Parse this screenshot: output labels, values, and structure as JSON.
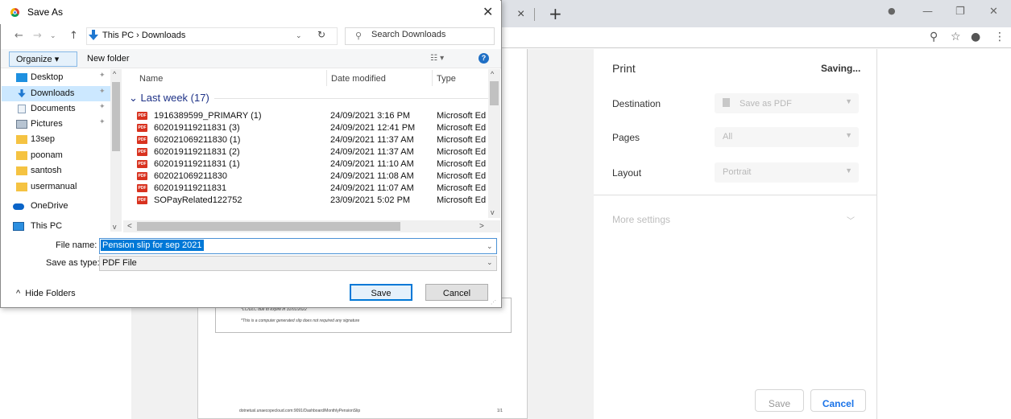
{
  "dialog": {
    "title": "Save As",
    "address": "This PC  ›  Downloads",
    "search_placeholder": "Search Downloads",
    "organize_label": "Organize ▾",
    "new_folder_label": "New folder",
    "help_label": "?",
    "nav_items": [
      {
        "label": "Desktop",
        "icon": "desktop-icon"
      },
      {
        "label": "Downloads",
        "icon": "downloads-icon",
        "selected": true
      },
      {
        "label": "Documents",
        "icon": "documents-icon"
      },
      {
        "label": "Pictures",
        "icon": "pictures-icon"
      },
      {
        "label": "13sep",
        "icon": "folder-icon"
      },
      {
        "label": "poonam",
        "icon": "folder-icon"
      },
      {
        "label": "santosh",
        "icon": "folder-icon"
      },
      {
        "label": "usermanual",
        "icon": "folder-icon"
      },
      {
        "label": "OneDrive",
        "icon": "onedrive-icon"
      },
      {
        "label": "This PC",
        "icon": "this-pc-icon"
      }
    ],
    "columns": {
      "name": "Name",
      "date": "Date modified",
      "type": "Type"
    },
    "group": "Last week (17)",
    "files": [
      {
        "name": "1916389599_PRIMARY (1)",
        "date": "24/09/2021 3:16 PM",
        "type": "Microsoft Ed"
      },
      {
        "name": "602019119211831 (3)",
        "date": "24/09/2021 12:41 PM",
        "type": "Microsoft Ed"
      },
      {
        "name": "602021069211830 (1)",
        "date": "24/09/2021 11:37 AM",
        "type": "Microsoft Ed"
      },
      {
        "name": "602019119211831 (2)",
        "date": "24/09/2021 11:37 AM",
        "type": "Microsoft Ed"
      },
      {
        "name": "602019119211831 (1)",
        "date": "24/09/2021 11:10 AM",
        "type": "Microsoft Ed"
      },
      {
        "name": "602021069211830",
        "date": "24/09/2021 11:08 AM",
        "type": "Microsoft Ed"
      },
      {
        "name": "602019119211831",
        "date": "24/09/2021 11:07 AM",
        "type": "Microsoft Ed"
      },
      {
        "name": "SOPayRelated122752",
        "date": "23/09/2021 5:02 PM",
        "type": "Microsoft Ed"
      }
    ],
    "file_name_label": "File name:",
    "file_name_value": "Pension slip for sep 2021",
    "save_type_label": "Save as type:",
    "save_type_value": "PDF File",
    "hide_folders_label": "Hide Folders",
    "save_label": "Save",
    "cancel_label": "Cancel"
  },
  "print": {
    "title": "Print",
    "status": "Saving...",
    "destination_label": "Destination",
    "destination_value": "Save as PDF",
    "pages_label": "Pages",
    "pages_value": "All",
    "layout_label": "Layout",
    "layout_value": "Portrait",
    "more_settings_label": "More settings",
    "save_label": "Save",
    "cancel_label": "Cancel"
  },
  "preview": {
    "note1": "*LC/DLC due to expire in 31/01/2022",
    "note2": "*This is a computer generated slip does not required any signature",
    "footer_url": "dotnetusl.unaecopecloud.com:9091/Dashboard/MonthlyPensionSlip",
    "footer_page": "1/1"
  },
  "colors": {
    "accent": "#0078d7",
    "chrome_link": "#1a73e8",
    "pdf_red": "#d8321f"
  }
}
